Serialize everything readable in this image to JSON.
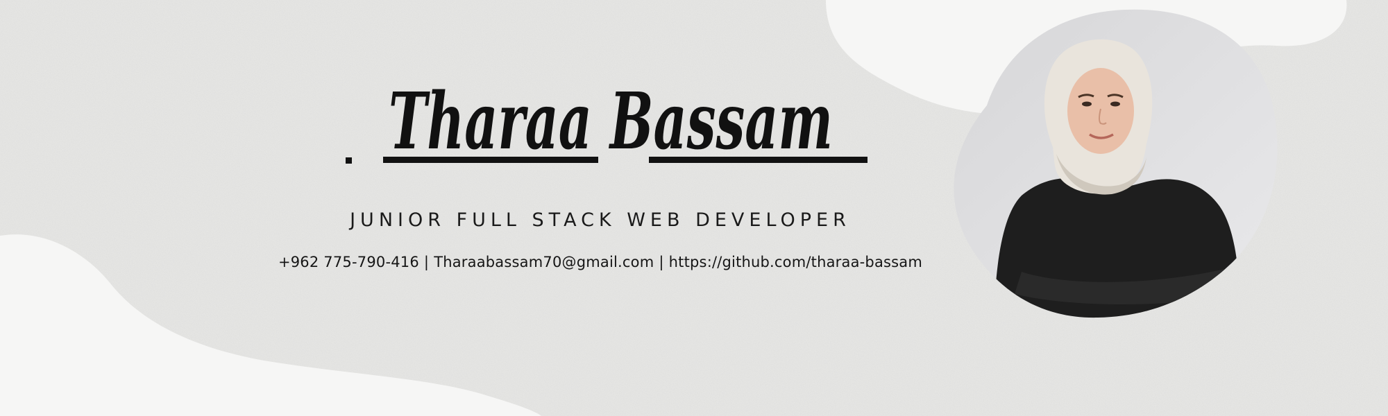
{
  "profile": {
    "name": "Tharaa Bassam",
    "role": "JUNIOR FULL STACK WEB DEVELOPER",
    "phone": "+962 775-790-416",
    "email": "Tharaabassam70@gmail.com",
    "github": "https://github.com/tharaa-bassam",
    "separator": "|"
  },
  "colors": {
    "background": "#e8e8e6",
    "blob": "#f6f6f5",
    "text": "#111111",
    "photo_backdrop": "#dcdcde",
    "hijab": "#e9e4dc",
    "clothing": "#1e1e1e"
  },
  "icons": {
    "portrait": "portrait-photo"
  }
}
